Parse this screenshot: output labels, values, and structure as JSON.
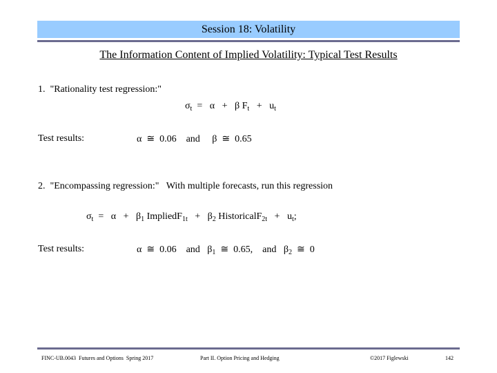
{
  "header": {
    "title": "Session 18:  Volatility",
    "accent_color": "#99ccff",
    "divider_color": "#6b6b8f"
  },
  "subtitle": "The Information Content of Implied Volatility: Typical Test Results",
  "section1": {
    "label": "1.  \"Rationality test regression:\"",
    "equation": {
      "sigma": "σ",
      "sigma_sub": "t",
      "eq": "  =   ",
      "alpha": "α",
      "plus1": "   +   ",
      "beta": "β",
      "F": " F",
      "F_sub": "t",
      "plus2": "   +   ",
      "u": "u",
      "u_sub": "t"
    },
    "results_label": "Test results:",
    "results": "α  ≅  0.06    and     β  ≅  0.65"
  },
  "section2": {
    "label": "2.  \"Encompassing regression:\"   With multiple forecasts, run this regression",
    "equation": {
      "sigma": "σ",
      "sigma_sub": "t",
      "eq": "  =   ",
      "alpha": "α",
      "plus1": "   +   ",
      "beta1": "β",
      "beta1_sub": "1",
      "implied": " ImpliedF",
      "implied_sub": "1t",
      "plus2": "   +   ",
      "beta2": "β",
      "beta2_sub": "2",
      "historical": " HistoricalF",
      "historical_sub": "2t",
      "plus3": "   +   ",
      "u": "u",
      "u_sub": "t",
      "end": ";"
    },
    "results_label": "Test results:",
    "results": {
      "alpha": "α  ≅  0.06    and   β",
      "b1_sub": "1",
      "b1_val": "  ≅  0.65,    and   β",
      "b2_sub": "2",
      "b2_val": "  ≅  0"
    }
  },
  "footer": {
    "course": "FINC-UB.0043  Futures and Options  Spring 2017",
    "part": "Part II. Option Pricing and Hedging",
    "copyright": "©2017 Figlewski",
    "page": "142"
  }
}
